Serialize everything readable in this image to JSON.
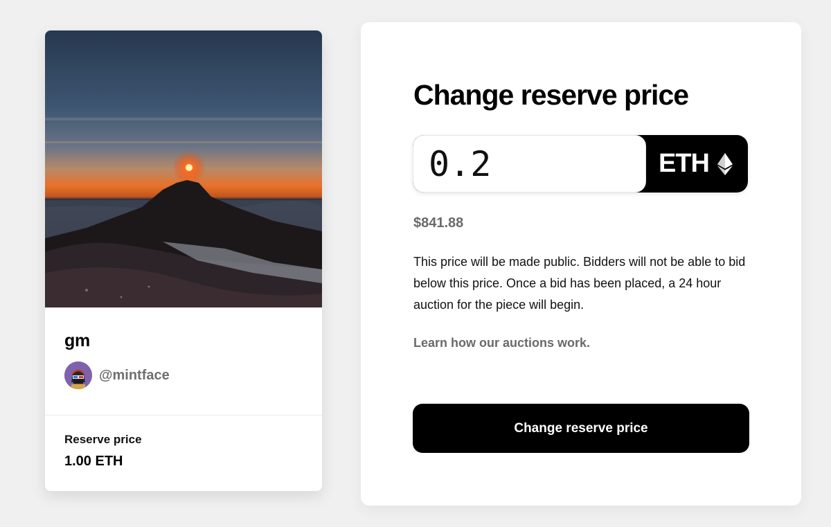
{
  "artwork": {
    "title": "gm",
    "creator_handle": "@mintface",
    "reserve_label": "Reserve price",
    "reserve_value": "1.00 ETH",
    "image_icon": "mountain-sunrise-image",
    "avatar_icon": "avatar-image"
  },
  "form": {
    "title": "Change reserve price",
    "price_value": "0.2",
    "currency": "ETH",
    "currency_icon": "ethereum-icon",
    "usd_value": "$841.88",
    "description": "This price will be made public. Bidders will not be able to bid below this price. Once a bid has been placed, a 24 hour auction for the piece will begin.",
    "learn_link": "Learn how our auctions work.",
    "submit_label": "Change reserve price"
  },
  "colors": {
    "background": "#f0f0f0",
    "button": "#000000",
    "muted_text": "#6a6a6a"
  }
}
